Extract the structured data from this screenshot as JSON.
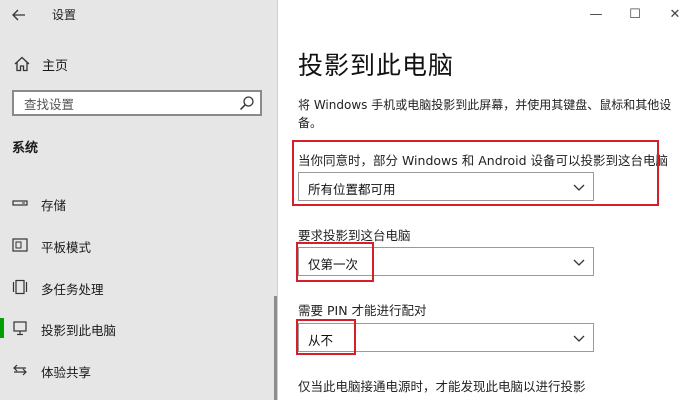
{
  "window": {
    "title": "设置",
    "minimize_glyph": "—",
    "maximize_glyph": "☐",
    "close_glyph": "✕"
  },
  "sidebar": {
    "home_label": "主页",
    "search_placeholder": "查找设置",
    "section_title": "系统",
    "items": [
      {
        "label": "存储",
        "icon": "storage-icon"
      },
      {
        "label": "平板模式",
        "icon": "tablet-mode-icon"
      },
      {
        "label": "多任务处理",
        "icon": "multitasking-icon"
      },
      {
        "label": "投影到此电脑",
        "icon": "project-to-pc-icon",
        "active": true
      },
      {
        "label": "体验共享",
        "icon": "shared-experiences-icon"
      }
    ]
  },
  "main": {
    "title": "投影到此电脑",
    "description": "将 Windows 手机或电脑投影到此屏幕，并使用其键盘、鼠标和其他设备。",
    "settings": [
      {
        "label": "当你同意时，部分 Windows 和 Android 设备可以投影到这台电脑",
        "value": "所有位置都可用"
      },
      {
        "label": "要求投影到这台电脑",
        "value": "仅第一次"
      },
      {
        "label": "需要 PIN 才能进行配对",
        "value": "从不"
      }
    ],
    "footer_label": "仅当此电脑接通电源时，才能发现此电脑以进行投影"
  },
  "colors": {
    "sidebar_bg": "#e6e6e6",
    "accent": "#00a000",
    "highlight_box": "#d4202a"
  }
}
